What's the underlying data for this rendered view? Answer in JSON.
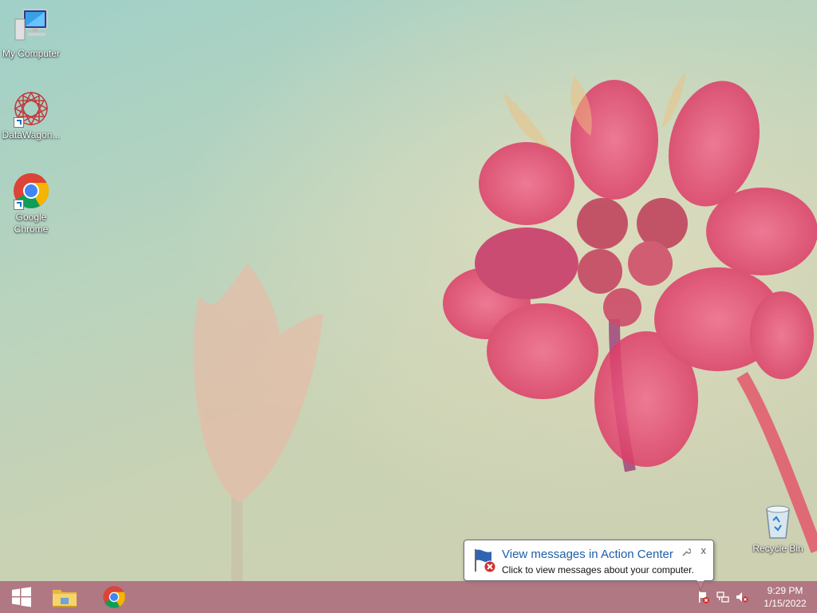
{
  "desktop": {
    "icons": [
      {
        "label": "My Computer",
        "icon": "computer-icon"
      },
      {
        "label": "DataWagon...",
        "icon": "datawagon-icon"
      },
      {
        "label": "Google Chrome",
        "icon": "chrome-icon"
      },
      {
        "label": "Recycle Bin",
        "icon": "recycle-bin-icon"
      }
    ]
  },
  "notification": {
    "title": "View messages in Action Center",
    "message": "Click to view messages about your computer.",
    "close_glyph": "x",
    "icon": "action-center-flag-icon"
  },
  "taskbar": {
    "start_icon": "windows-logo-icon",
    "pinned": [
      "file-explorer-icon",
      "chrome-icon"
    ],
    "tray_icons": [
      "action-center-icon",
      "network-icon",
      "volume-muted-icon"
    ],
    "clock": {
      "time": "9:29 PM",
      "date": "1/15/2022"
    }
  },
  "colors": {
    "taskbar": "#aa6478",
    "balloon_title": "#1d5fa8",
    "flower": "#e0426e"
  }
}
